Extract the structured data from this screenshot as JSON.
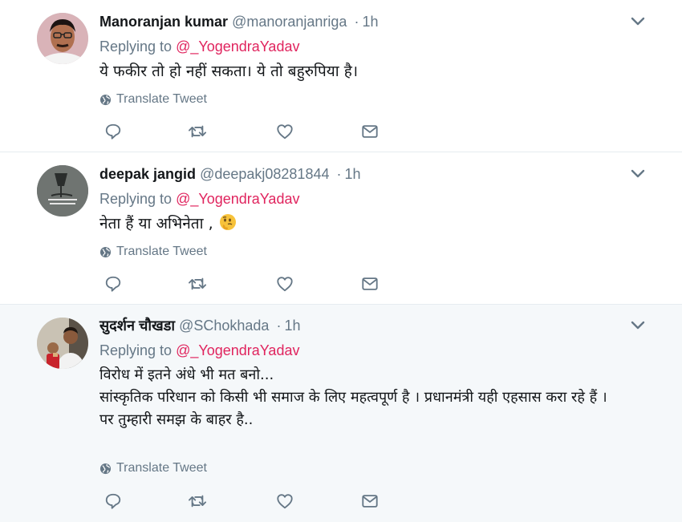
{
  "tweets": [
    {
      "fullname": "Manoranjan kumar",
      "username": "@manoranjanriga",
      "dot": "·",
      "time": "1h",
      "replying_prefix": "Replying to ",
      "replying_to": "@_YogendraYadav",
      "text": "ये फकीर तो हो नहीं सकता। ये तो बहुरुपिया है।",
      "translate_label": "Translate Tweet"
    },
    {
      "fullname": "deepak jangid",
      "username": "@deepakj08281844",
      "dot": "·",
      "time": "1h",
      "replying_prefix": "Replying to ",
      "replying_to": "@_YogendraYadav",
      "text": "नेता हैं या अभिनेता ,",
      "emoji": "thinking-face",
      "translate_label": "Translate Tweet"
    },
    {
      "fullname": "सुदर्शन चौखडा",
      "username": "@SChokhada",
      "dot": "·",
      "time": "1h",
      "replying_prefix": "Replying to ",
      "replying_to": "@_YogendraYadav",
      "text": "विरोध में इतने अंधे भी मत बनो...\nसांस्कृतिक परिधान को किसी भी समाज के लिए महत्वपूर्ण है । प्रधानमंत्री यही एहसास करा रहे हैं ।\nपर तुम्हारी समझ के बाहर है..",
      "translate_label": "Translate Tweet"
    }
  ],
  "colors": {
    "mention": "#e0245e",
    "secondary_text": "#657786",
    "highlight_bg": "#f5f8fa",
    "divider": "#e6ecf0"
  },
  "icons": [
    "chevron-down-icon",
    "globe-icon",
    "reply-icon",
    "retweet-icon",
    "like-icon",
    "message-icon"
  ]
}
